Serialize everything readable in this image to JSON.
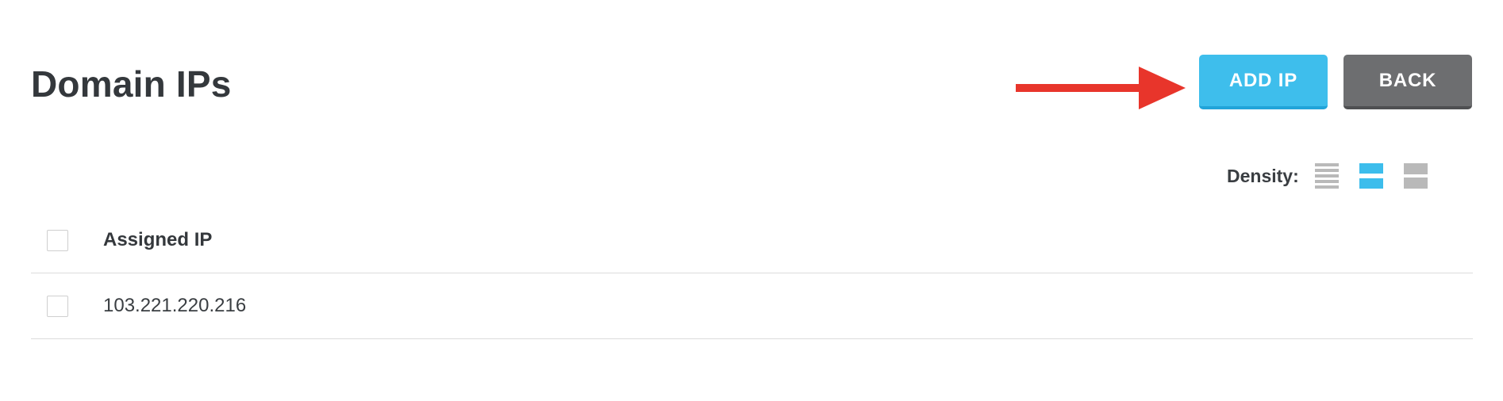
{
  "header": {
    "title": "Domain IPs",
    "add_button_label": "ADD IP",
    "back_button_label": "BACK"
  },
  "annotation": {
    "arrow_color": "#e8352b",
    "arrow_icon": "red-arrow-pointing-right"
  },
  "density": {
    "label": "Density:",
    "options": [
      "compact-density-icon",
      "normal-density-icon",
      "comfortable-density-icon"
    ],
    "selected": "normal",
    "accent_color": "#3cbdec"
  },
  "table": {
    "columns": [
      "Assigned IP"
    ],
    "rows": [
      {
        "ip": "103.221.220.216"
      }
    ]
  },
  "colors": {
    "add_button": "#3ebeec",
    "back_button": "#6d6e70"
  }
}
